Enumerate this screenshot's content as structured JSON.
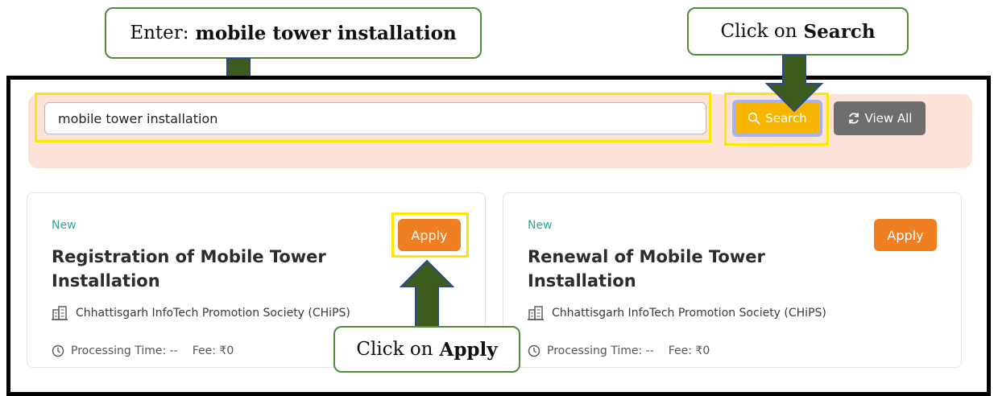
{
  "callouts": {
    "enter_prefix": "Enter:",
    "enter_value": "mobile tower installation",
    "search_prefix": "Click on",
    "search_bold": "Search",
    "apply_prefix": "Click on",
    "apply_bold": "Apply"
  },
  "search": {
    "value": "mobile tower installation",
    "button_label": "Search",
    "view_all_label": "View All"
  },
  "cards": [
    {
      "badge": "New",
      "title": "Registration of Mobile Tower Installation",
      "apply_label": "Apply",
      "department": "Chhattisgarh InfoTech Promotion Society (CHiPS)",
      "processing_label": "Processing Time: --",
      "fee_label": "Fee: ₹0"
    },
    {
      "badge": "New",
      "title": "Renewal of Mobile Tower Installation",
      "apply_label": "Apply",
      "department": "Chhattisgarh InfoTech Promotion Society (CHiPS)",
      "processing_label": "Processing Time: --",
      "fee_label": "Fee: ₹0"
    }
  ],
  "colors": {
    "search_band": "#fde2da",
    "search_button": "#f7b500",
    "apply_button": "#f07f22",
    "view_all_button": "#6e6e6e",
    "highlight": "#ffe600",
    "arrow": "#3d5c1e",
    "badge": "#2fa796"
  }
}
